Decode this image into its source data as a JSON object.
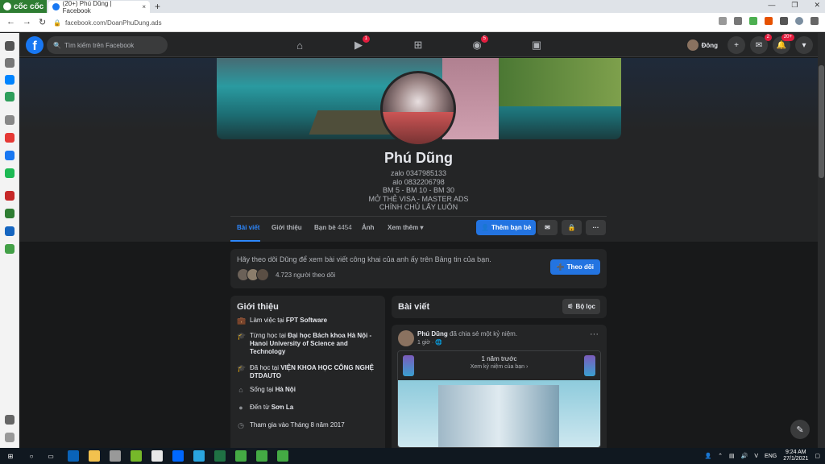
{
  "browser": {
    "brand": "cốc cốc",
    "tab_title": "(20+) Phú Dũng | Facebook",
    "tab_close": "×",
    "new_tab": "+",
    "url": "facebook.com/DoanPhuDung.ads",
    "controls": [
      "—",
      "❐",
      "✕"
    ],
    "nav_back": "←",
    "nav_forward": "→",
    "nav_reload": "↻"
  },
  "fb": {
    "search_placeholder": "Tìm kiếm trên Facebook",
    "watch_badge": "1",
    "groups_badge": "5",
    "user_name": "Đông",
    "messenger_badge": "2",
    "notif_badge": "20+"
  },
  "profile": {
    "name": "Phú Dũng",
    "bio": [
      "zalo 0347985133",
      "alo 0832206798",
      "BM 5 - BM 10 - BM 30",
      "MỞ THẺ VISA - MASTER ADS",
      "CHÍNH CHỦ LẤY LUÔN"
    ],
    "tabs": {
      "posts": "Bài viết",
      "about": "Giới thiệu",
      "friends": "Bạn bè",
      "friends_count": "4454",
      "photos": "Ảnh",
      "more": "Xem thêm"
    },
    "add_friend": "Thêm bạn bè"
  },
  "follow": {
    "text": "Hãy theo dõi Dũng để xem bài viết công khai của anh ấy trên Bảng tin của bạn.",
    "count": "4.723 người theo dõi",
    "button": "Theo dõi"
  },
  "intro": {
    "title": "Giới thiệu",
    "items": [
      {
        "icon": "work-icon",
        "pre": "Làm việc tại ",
        "bold": "FPT Software"
      },
      {
        "icon": "education-icon",
        "pre": "Từng học tại ",
        "bold": "Đại học Bách khoa Hà Nội - Hanoi University of Science and Technology"
      },
      {
        "icon": "education-icon",
        "pre": "Đã học tại ",
        "bold": "VIỆN KHOA HỌC CÔNG NGHỆ DTDAUTO"
      },
      {
        "icon": "home-icon",
        "pre": "Sống tại ",
        "bold": "Hà Nội"
      },
      {
        "icon": "location-icon",
        "pre": "Đến từ ",
        "bold": "Sơn La"
      },
      {
        "icon": "clock-icon",
        "pre": "Tham gia vào Tháng 8 năm 2017",
        "bold": ""
      }
    ]
  },
  "posts_header": {
    "title": "Bài viết",
    "filter": "Bộ lọc"
  },
  "post": {
    "author": "Phú Dũng",
    "action": " đã chia sẻ một kỷ niệm.",
    "time": "1 giờ · ",
    "memory_title": "1 năm trước",
    "memory_sub": "Xem kỷ niệm của bạn ›"
  },
  "taskbar": {
    "lang": "ENG",
    "time": "9:24 AM",
    "date": "27/1/2021"
  }
}
